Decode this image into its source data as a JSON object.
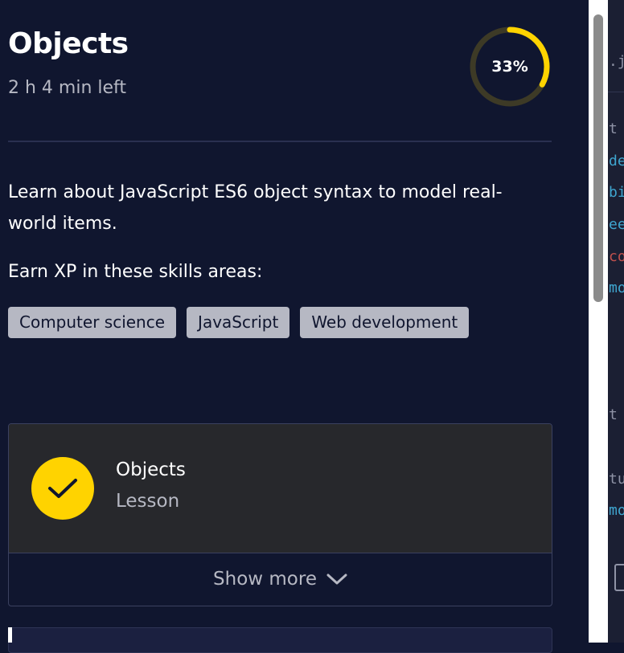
{
  "header": {
    "title": "Objects",
    "time_left": "2 h 4 min left",
    "progress": {
      "percent": 33,
      "label": "33%"
    }
  },
  "description": "Learn about JavaScript ES6 object syntax to model real-world items.",
  "skills": {
    "heading": "Earn XP in these skills areas:",
    "tags": [
      "Computer science",
      "JavaScript",
      "Web development"
    ]
  },
  "lesson_card": {
    "title": "Objects",
    "type": "Lesson",
    "completed": true,
    "show_more_label": "Show more"
  },
  "editor_peek": {
    "tab_fragment": ".js",
    "code_fragments": [
      {
        "text": "t",
        "color": "#8f93a6"
      },
      {
        "text": "de",
        "color": "#3fa5cf"
      },
      {
        "text": "bi",
        "color": "#3fa5cf"
      },
      {
        "text": "ee",
        "color": "#3fa5cf"
      },
      {
        "text": "co",
        "color": "#c0504d"
      },
      {
        "text": "mo",
        "color": "#3fa5cf"
      },
      {
        "text": "t",
        "color": "#8f93a6"
      },
      {
        "text": "tu",
        "color": "#8f93a6"
      },
      {
        "text": "mo",
        "color": "#3fa5cf"
      }
    ]
  },
  "colors": {
    "background": "#10162f",
    "accent_yellow": "#ffd300",
    "muted_text": "#b6b8c3",
    "card_bg": "#27282c",
    "tag_bg": "#b6b8c3"
  }
}
